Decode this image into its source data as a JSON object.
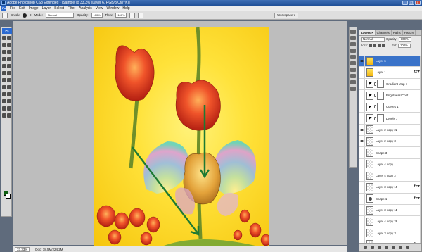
{
  "window": {
    "title": "Adobe Photoshop CS3 Extended - [Sample @ 33.3% (Layer 6, RGB/8/CMYK)]",
    "controls": [
      "_",
      "❐",
      "✕"
    ]
  },
  "menu": {
    "items": [
      "File",
      "Edit",
      "Image",
      "Layer",
      "Select",
      "Filter",
      "Analysis",
      "View",
      "Window",
      "Help"
    ]
  },
  "options": {
    "brush_label": "Brush:",
    "brush_size": "9",
    "mode_label": "Mode:",
    "mode_value": "Normal",
    "opacity_label": "Opacity:",
    "opacity_value": "100%",
    "flow_label": "Flow:",
    "flow_value": "100%",
    "workspace_label": "Workspace ▾"
  },
  "status": {
    "zoom": "33.33%",
    "doc": "Doc: 18.5M/224.2M"
  },
  "layers_panel": {
    "tabs": [
      "Layers ×",
      "Channels",
      "Paths",
      "History"
    ],
    "blend_mode": "Normal",
    "opacity_label": "Opacity:",
    "opacity_value": "100%",
    "lock_label": "Lock:",
    "fill_label": "Fill:",
    "fill_value": "100%",
    "layers": [
      {
        "name": "Layer 6",
        "visible": true,
        "selected": true,
        "thumb": "img",
        "mask": false,
        "fx": false
      },
      {
        "name": "Layer 1",
        "visible": false,
        "selected": false,
        "thumb": "img",
        "mask": false,
        "fx": true
      },
      {
        "name": "Gradient Map 1",
        "visible": false,
        "selected": false,
        "thumb": "adj",
        "mask": true,
        "fx": false
      },
      {
        "name": "Brightness/Cont...",
        "visible": false,
        "selected": false,
        "thumb": "adj",
        "mask": true,
        "fx": false
      },
      {
        "name": "Curves 1",
        "visible": false,
        "selected": false,
        "thumb": "adj",
        "mask": true,
        "fx": false
      },
      {
        "name": "Levels 1",
        "visible": false,
        "selected": false,
        "thumb": "adj",
        "mask": true,
        "fx": false
      },
      {
        "name": "Layer 2 copy 22",
        "visible": true,
        "selected": false,
        "thumb": "checker",
        "mask": false,
        "fx": false
      },
      {
        "name": "Layer 2 copy 3",
        "visible": true,
        "selected": false,
        "thumb": "checker",
        "mask": false,
        "fx": false
      },
      {
        "name": "Shape 3",
        "visible": false,
        "selected": false,
        "thumb": "checker",
        "mask": false,
        "fx": false
      },
      {
        "name": "Layer 4 copy",
        "visible": false,
        "selected": false,
        "thumb": "checker",
        "mask": false,
        "fx": false
      },
      {
        "name": "Layer 4 copy 2",
        "visible": false,
        "selected": false,
        "thumb": "checker",
        "mask": false,
        "fx": false
      },
      {
        "name": "Layer 3 copy 15",
        "visible": false,
        "selected": false,
        "thumb": "checker",
        "mask": false,
        "fx": true
      },
      {
        "name": "Shape 1",
        "visible": false,
        "selected": false,
        "thumb": "shape",
        "mask": false,
        "fx": true
      },
      {
        "name": "Layer 3 copy 11",
        "visible": false,
        "selected": false,
        "thumb": "checker",
        "mask": false,
        "fx": false
      },
      {
        "name": "Layer 4 copy 28",
        "visible": false,
        "selected": false,
        "thumb": "checker",
        "mask": false,
        "fx": false
      },
      {
        "name": "Layer 3 copy 3",
        "visible": false,
        "selected": false,
        "thumb": "checker",
        "mask": false,
        "fx": false
      },
      {
        "name": "Layer 3 copy 5",
        "visible": false,
        "selected": false,
        "thumb": "checker",
        "mask": false,
        "fx": true
      }
    ]
  },
  "colors": {
    "foreground": "#0f5f12",
    "background": "#ffffff",
    "selection": "#3a73c9"
  }
}
